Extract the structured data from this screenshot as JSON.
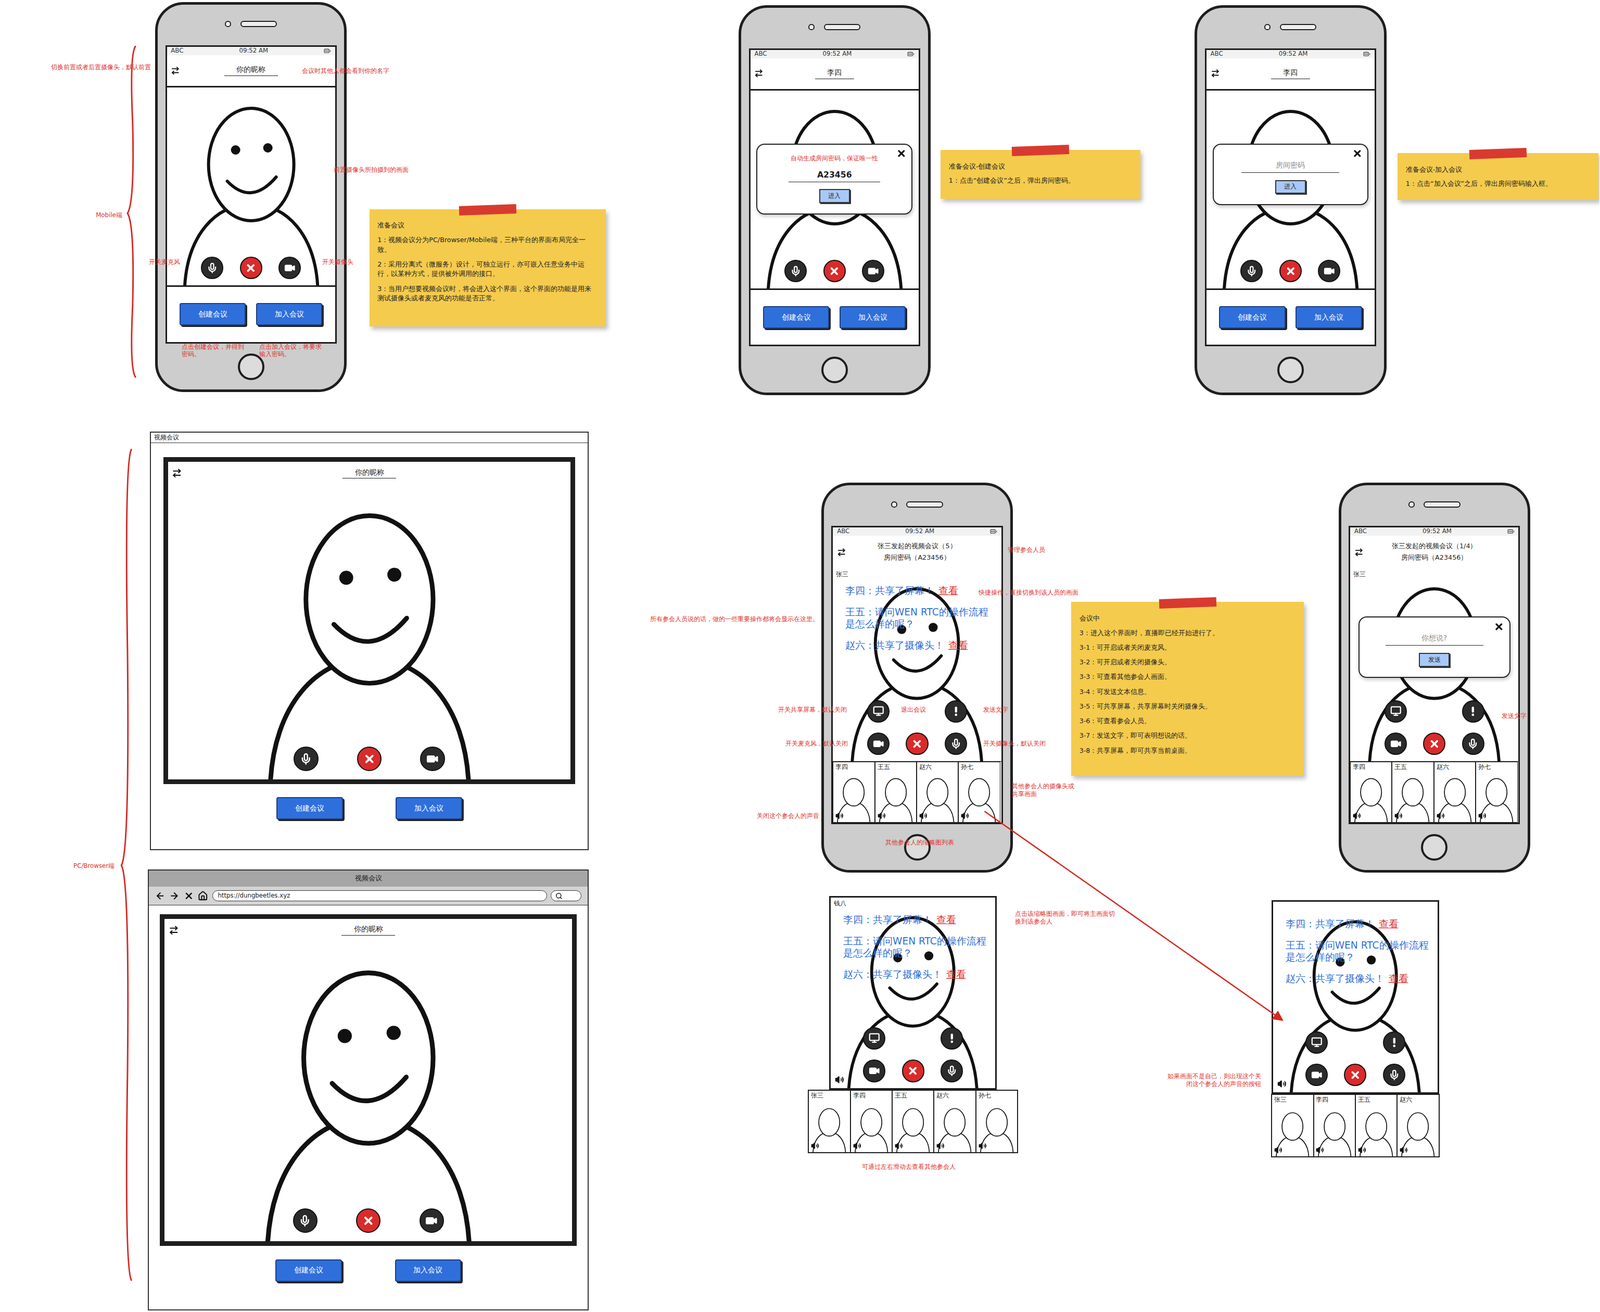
{
  "status_bar": {
    "carrier": "ABC",
    "time": "09:52 AM"
  },
  "side_labels": [
    {
      "text": "Mobile端"
    },
    {
      "text": "PC/Browser端"
    }
  ],
  "prepare_phones": [
    {
      "title": "你的昵称",
      "controls": [
        "mic",
        "hangup",
        "camera"
      ],
      "buttons": [
        "创建会议",
        "加入会议"
      ]
    },
    {
      "title": "李四",
      "controls": [
        "mic",
        "hangup",
        "camera"
      ],
      "buttons": [
        "创建会议",
        "加入会议"
      ],
      "dialog": {
        "kind": "create",
        "note": "自动生成房间密码，保证唯一性",
        "value": "A23456",
        "button": "进入"
      }
    },
    {
      "title": "李四",
      "controls": [
        "mic",
        "hangup",
        "camera"
      ],
      "buttons": [
        "创建会议",
        "加入会议"
      ],
      "dialog": {
        "kind": "join",
        "placeholder": "房间密码",
        "button": "进入"
      }
    }
  ],
  "windows": [
    {
      "kind": "desktop",
      "title": "视频会议",
      "nickname": "你的昵称",
      "controls": [
        "mic",
        "hangup",
        "camera"
      ],
      "buttons": [
        "创建会议",
        "加入会议"
      ]
    },
    {
      "kind": "browser",
      "title": "视频会议",
      "url": "https://dungbeetles.xyz",
      "nickname": "你的昵称",
      "controls": [
        "mic",
        "hangup",
        "camera"
      ],
      "buttons": [
        "创建会议",
        "加入会议"
      ]
    }
  ],
  "meetings": [
    {
      "frame": "phone",
      "title": "张三发起的视频会议（5）",
      "password": "房间密码（A23456）",
      "speaker": "张三",
      "mute_button": false,
      "chat": [
        {
          "name": "李四：",
          "text": "共享了屏幕！",
          "link": "查看"
        },
        {
          "name": "王五：",
          "text": "请问WEN RTC的操作流程是怎么样的呢？"
        },
        {
          "name": "赵六：",
          "text": "共享了摄像头！",
          "link": "查看"
        }
      ],
      "controls": [
        [
          "screen",
          "none",
          "alert"
        ],
        [
          "camera",
          "hangup",
          "mic"
        ]
      ],
      "participants": [
        "李四",
        "王五",
        "赵六",
        "孙七"
      ]
    },
    {
      "frame": "phone",
      "title": "张三发起的视频会议（1/4）",
      "password": "房间密码（A23456）",
      "speaker": "张三",
      "mute_button": false,
      "chat": [],
      "controls": [
        [
          "screen",
          "none",
          "alert"
        ],
        [
          "camera",
          "hangup",
          "mic"
        ]
      ],
      "participants": [
        "李四",
        "王五",
        "赵六",
        "孙七"
      ],
      "dialog": {
        "kind": "send",
        "placeholder": "你想说?",
        "button": "发送"
      }
    },
    {
      "frame": "bare",
      "speaker": "钱八",
      "mute_button": true,
      "chat": [
        {
          "name": "李四：",
          "text": "共享了屏幕！",
          "link": "查看"
        },
        {
          "name": "王五：",
          "text": "请问WEN RTC的操作流程是怎么样的呢？"
        },
        {
          "name": "赵六：",
          "text": "共享了摄像头！",
          "link": "查看"
        }
      ],
      "controls": [
        [
          "screen",
          "none",
          "alert"
        ],
        [
          "camera",
          "hangup",
          "mic"
        ]
      ],
      "participants": [
        "张三",
        "李四",
        "王五",
        "赵六",
        "孙七"
      ]
    },
    {
      "frame": "bare",
      "mute_button": true,
      "chat": [
        {
          "name": "李四：",
          "text": "共享了屏幕！",
          "link": "查看"
        },
        {
          "name": "王五：",
          "text": "请问WEN RTC的操作流程是怎么样的呢？"
        },
        {
          "name": "赵六：",
          "text": "共享了摄像头！",
          "link": "查看"
        }
      ],
      "controls": [
        [
          "screen",
          "none",
          "alert"
        ],
        [
          "camera",
          "hangup",
          "mic"
        ]
      ],
      "participants": [
        "张三",
        "李四",
        "王五",
        "赵六"
      ]
    }
  ],
  "notes": [
    {
      "title": "准备会议",
      "lines": [
        "1：视频会议分为PC/Browser/Mobile端，三种平台的界面布局完全一致。",
        "2：采用分离式（微服务）设计，可独立运行，亦可嵌入任意业务中运行，以某种方式，提供被外调用的接口。",
        "3：当用户想要视频会议时，将会进入这个界面，这个界面的功能是用来测试摄像头或者麦克风的功能是否正常。"
      ]
    },
    {
      "title": "准备会议-创建会议",
      "lines": [
        "1：点击“创建会议”之后，弹出房间密码。"
      ]
    },
    {
      "title": "准备会议-加入会议",
      "lines": [
        "1：点击“加入会议”之后，弹出房间密码输入框。"
      ]
    },
    {
      "title": "会议中",
      "lines": [
        "3：进入这个界面时，直播即已经开始进行了。",
        "3-1：可开启或者关闭麦克风。",
        "3-2：可开启或者关闭摄像头。",
        "3-3：可查看其他参会人画面。",
        "3-4：可发送文本信息。",
        "3-5：可共享屏幕，共享屏幕时关闭摄像头。",
        "3-6：可查看参会人员。",
        "3-7：发送文字，即可表明想说的话。",
        "3-8：共享屏幕，即可共享当前桌面。"
      ]
    }
  ],
  "annotations": [
    "切换前置或者后置摄像头，默认前置",
    "会议时其他人都会看到你的名字",
    "前置摄像头所拍摄到的画面",
    "开关麦克风",
    "开关摄像头",
    "点击创建会议，并得到密码。",
    "点击加入会议，将要求输入密码。",
    "管理参会人员",
    "快捷操作，直接切换到该人员的画面",
    "所有参会人员说的话，做的一些重要操作都将会显示在这里。",
    "开关共享屏幕，默认关闭",
    "退出会议",
    "发送文字",
    "开关麦克风，默认关闭",
    "开关摄像头，默认关闭",
    "其他参会人的摄像头或共享画面",
    "关闭这个参会人的声音",
    "其他参会人的缩略图列表",
    "发送文字",
    "点击该缩略图画面，即可将主画面切换到该参会人",
    "可通过左右滑动去查看其他参会人",
    "如果画面不是自己，则出现这个关闭这个参会人的声音的按钮"
  ]
}
